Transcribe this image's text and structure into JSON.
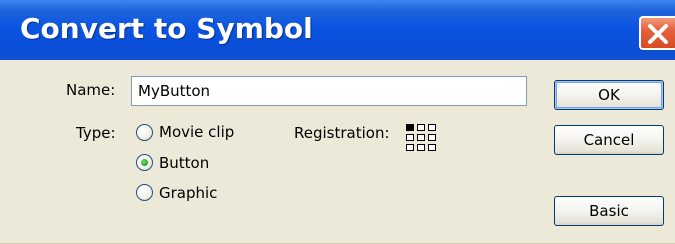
{
  "dialog": {
    "title": "Convert to Symbol",
    "name_label": "Name:",
    "name_value": "MyButton",
    "type_label": "Type:",
    "types": [
      {
        "label": "Movie clip",
        "selected": false
      },
      {
        "label": "Button",
        "selected": true
      },
      {
        "label": "Graphic",
        "selected": false
      }
    ],
    "registration_label": "Registration:",
    "registration_selected": "top-left",
    "buttons": {
      "ok": "OK",
      "cancel": "Cancel",
      "basic": "Basic"
    }
  },
  "colors": {
    "titlebar": "#0a4fd8",
    "close_button": "#d84a22",
    "dialog_background": "#ece9d8",
    "radio_selected": "#21a121"
  },
  "icons": {
    "close": "close-x-icon",
    "registration": "registration-grid-icon"
  }
}
